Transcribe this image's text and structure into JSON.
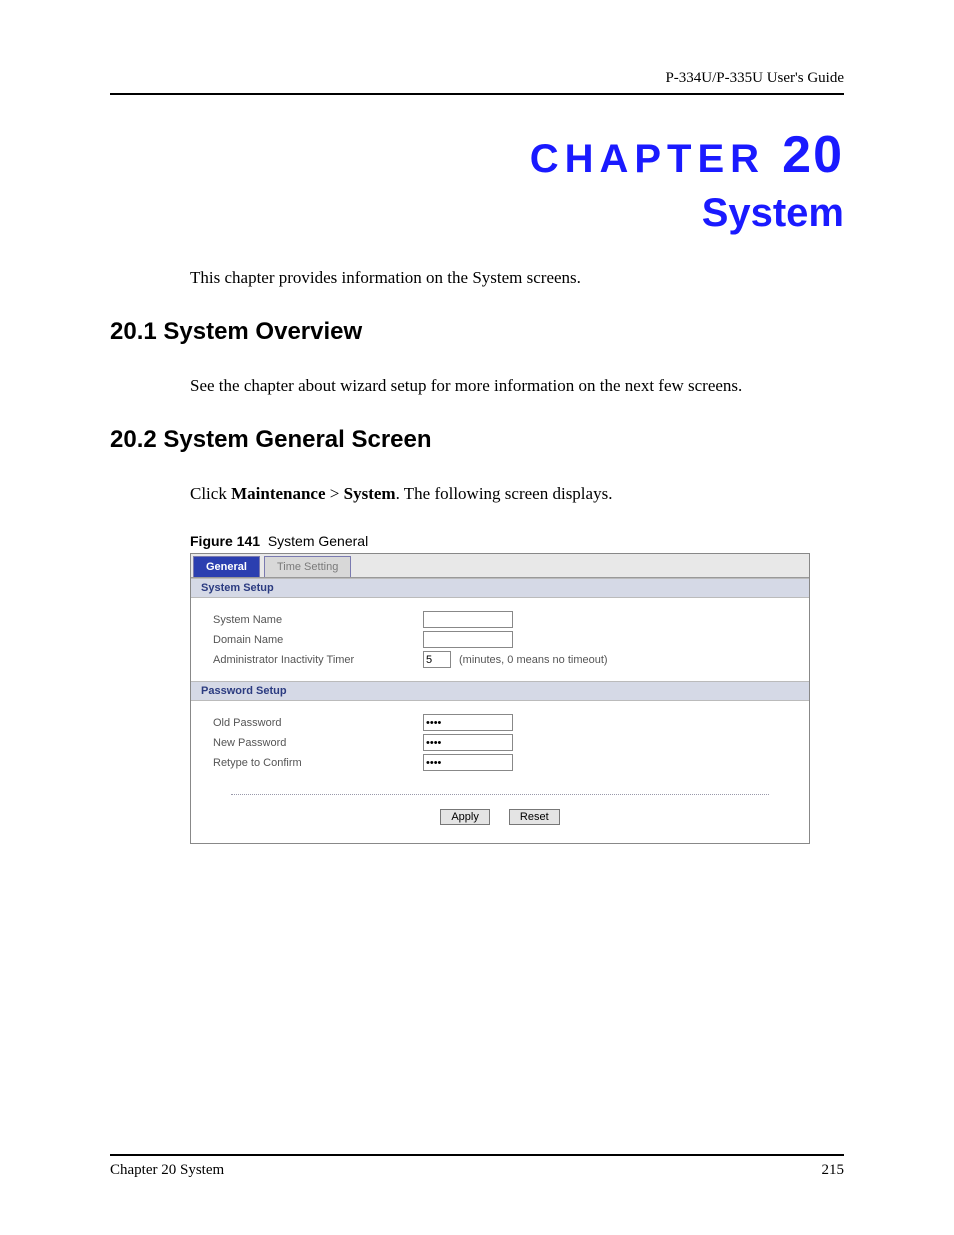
{
  "header": {
    "guide_title": "P-334U/P-335U User's Guide"
  },
  "chapter": {
    "label": "CHAPTER",
    "number": "20",
    "title": "System"
  },
  "intro": "This chapter provides information on the System screens.",
  "sections": {
    "s1": {
      "heading": "20.1  System Overview",
      "body": "See the chapter about wizard setup for more information on the next few screens."
    },
    "s2": {
      "heading": "20.2  System General Screen",
      "body_prefix": "Click ",
      "body_b1": "Maintenance",
      "body_mid": " > ",
      "body_b2": "System",
      "body_suffix": ". The following screen displays."
    }
  },
  "figure": {
    "caption_label": "Figure 141",
    "caption_text": "System General"
  },
  "screenshot": {
    "tabs": {
      "active": "General",
      "inactive": "Time Setting"
    },
    "system_setup": {
      "bar": "System Setup",
      "rows": {
        "system_name": {
          "label": "System Name",
          "value": ""
        },
        "domain_name": {
          "label": "Domain Name",
          "value": ""
        },
        "timer": {
          "label": "Administrator Inactivity Timer",
          "value": "5",
          "hint": "(minutes, 0 means no timeout)"
        }
      }
    },
    "password_setup": {
      "bar": "Password Setup",
      "rows": {
        "old": {
          "label": "Old Password",
          "value": "****"
        },
        "new": {
          "label": "New Password",
          "value": "****"
        },
        "retype": {
          "label": "Retype to Confirm",
          "value": "****"
        }
      }
    },
    "buttons": {
      "apply": "Apply",
      "reset": "Reset"
    }
  },
  "footer": {
    "left": "Chapter 20 System",
    "right": "215"
  }
}
